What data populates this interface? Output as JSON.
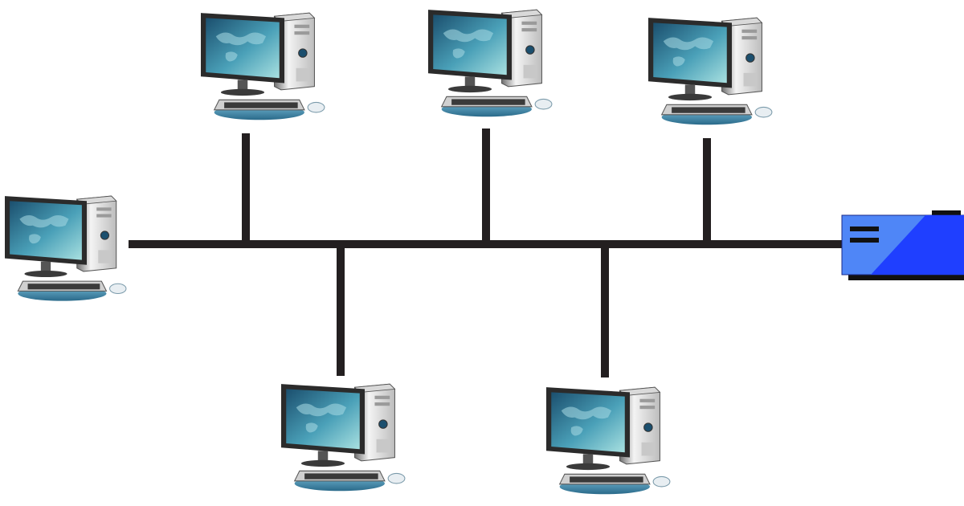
{
  "diagram": {
    "kind": "bus-topology",
    "bus_color": "#231f20",
    "nodes": [
      {
        "id": "pc-left",
        "type": "computer",
        "side": "left-end"
      },
      {
        "id": "pc-top-1",
        "type": "computer",
        "side": "above"
      },
      {
        "id": "pc-top-2",
        "type": "computer",
        "side": "above"
      },
      {
        "id": "pc-top-3",
        "type": "computer",
        "side": "above"
      },
      {
        "id": "pc-bottom-1",
        "type": "computer",
        "side": "below"
      },
      {
        "id": "pc-bottom-2",
        "type": "computer",
        "side": "below"
      },
      {
        "id": "server",
        "type": "server",
        "side": "right-end",
        "color": "#1f3fff"
      }
    ],
    "colors": {
      "screen_dark": "#1f5a7a",
      "screen_light": "#8fd0d8",
      "tower_light": "#f2f2f2",
      "tower_dark": "#8a8a8a",
      "keyboard_pad": "#3f87a8",
      "server_light": "#4f86f7",
      "server_dark": "#1f3fff"
    }
  }
}
